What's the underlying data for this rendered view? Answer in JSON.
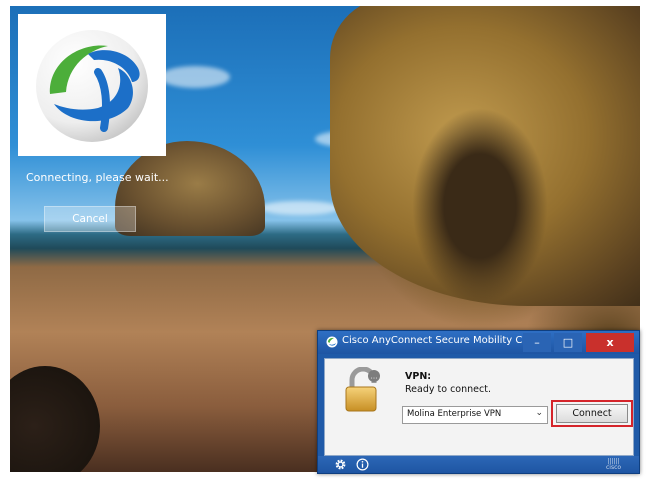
{
  "desktop": {
    "connecting_text": "Connecting, please wait...",
    "cancel_label": "Cancel"
  },
  "anyconnect": {
    "title": "Cisco AnyConnect Secure Mobility Client",
    "window_buttons": {
      "minimize": "–",
      "maximize": "□",
      "close": "x"
    },
    "vpn_label": "VPN:",
    "status": "Ready to connect.",
    "selected_server": "Molina Enterprise VPN",
    "connect_label": "Connect",
    "highlight_color": "#d5242a",
    "icons": {
      "title": "anyconnect-globe-icon",
      "lock": "lock-icon",
      "settings": "gear-icon",
      "info": "info-icon"
    }
  },
  "colors": {
    "window_blue": "#1f5aa8",
    "close_red": "#c9302c",
    "logo_blue": "#1c6fc8",
    "logo_green": "#4cae3a"
  }
}
